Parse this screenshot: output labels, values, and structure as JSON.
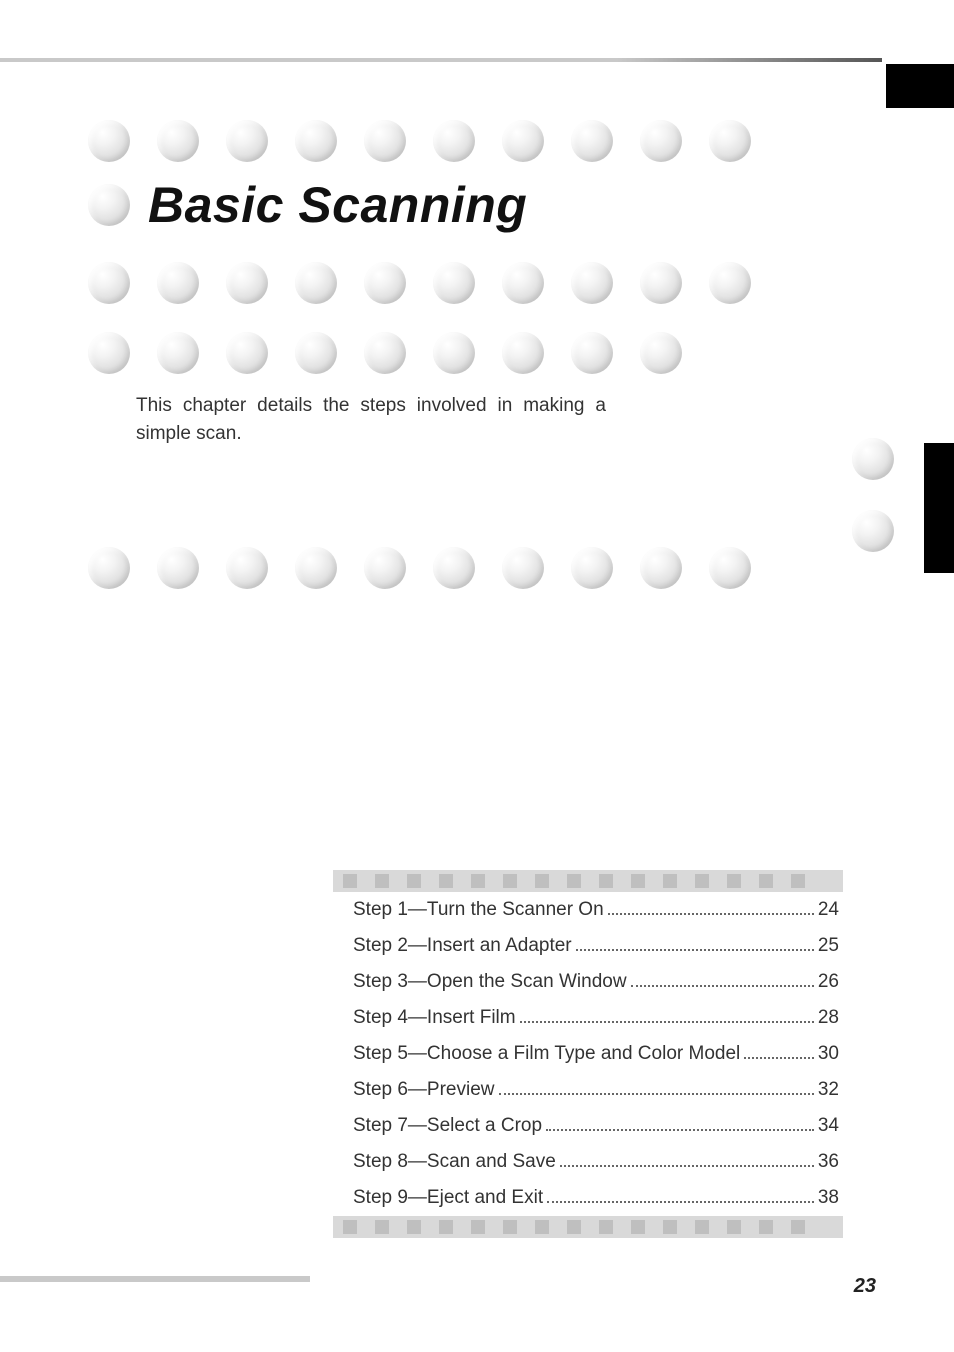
{
  "heading": "Basic Scanning",
  "intro": "This chapter details the steps involved in making a simple scan.",
  "toc": [
    {
      "label": "Step 1—Turn the Scanner On",
      "page": "24"
    },
    {
      "label": "Step 2—Insert an Adapter",
      "page": "25"
    },
    {
      "label": "Step 3—Open the Scan Window",
      "page": "26"
    },
    {
      "label": "Step 4—Insert Film",
      "page": "28"
    },
    {
      "label": "Step 5—Choose a Film Type and Color Model",
      "page": "30"
    },
    {
      "label": "Step 6—Preview",
      "page": "32"
    },
    {
      "label": "Step 7—Select a Crop",
      "page": "34"
    },
    {
      "label": "Step 8—Scan and Save",
      "page": "36"
    },
    {
      "label": "Step 9—Eject and Exit",
      "page": "38"
    }
  ],
  "page_number": "23"
}
